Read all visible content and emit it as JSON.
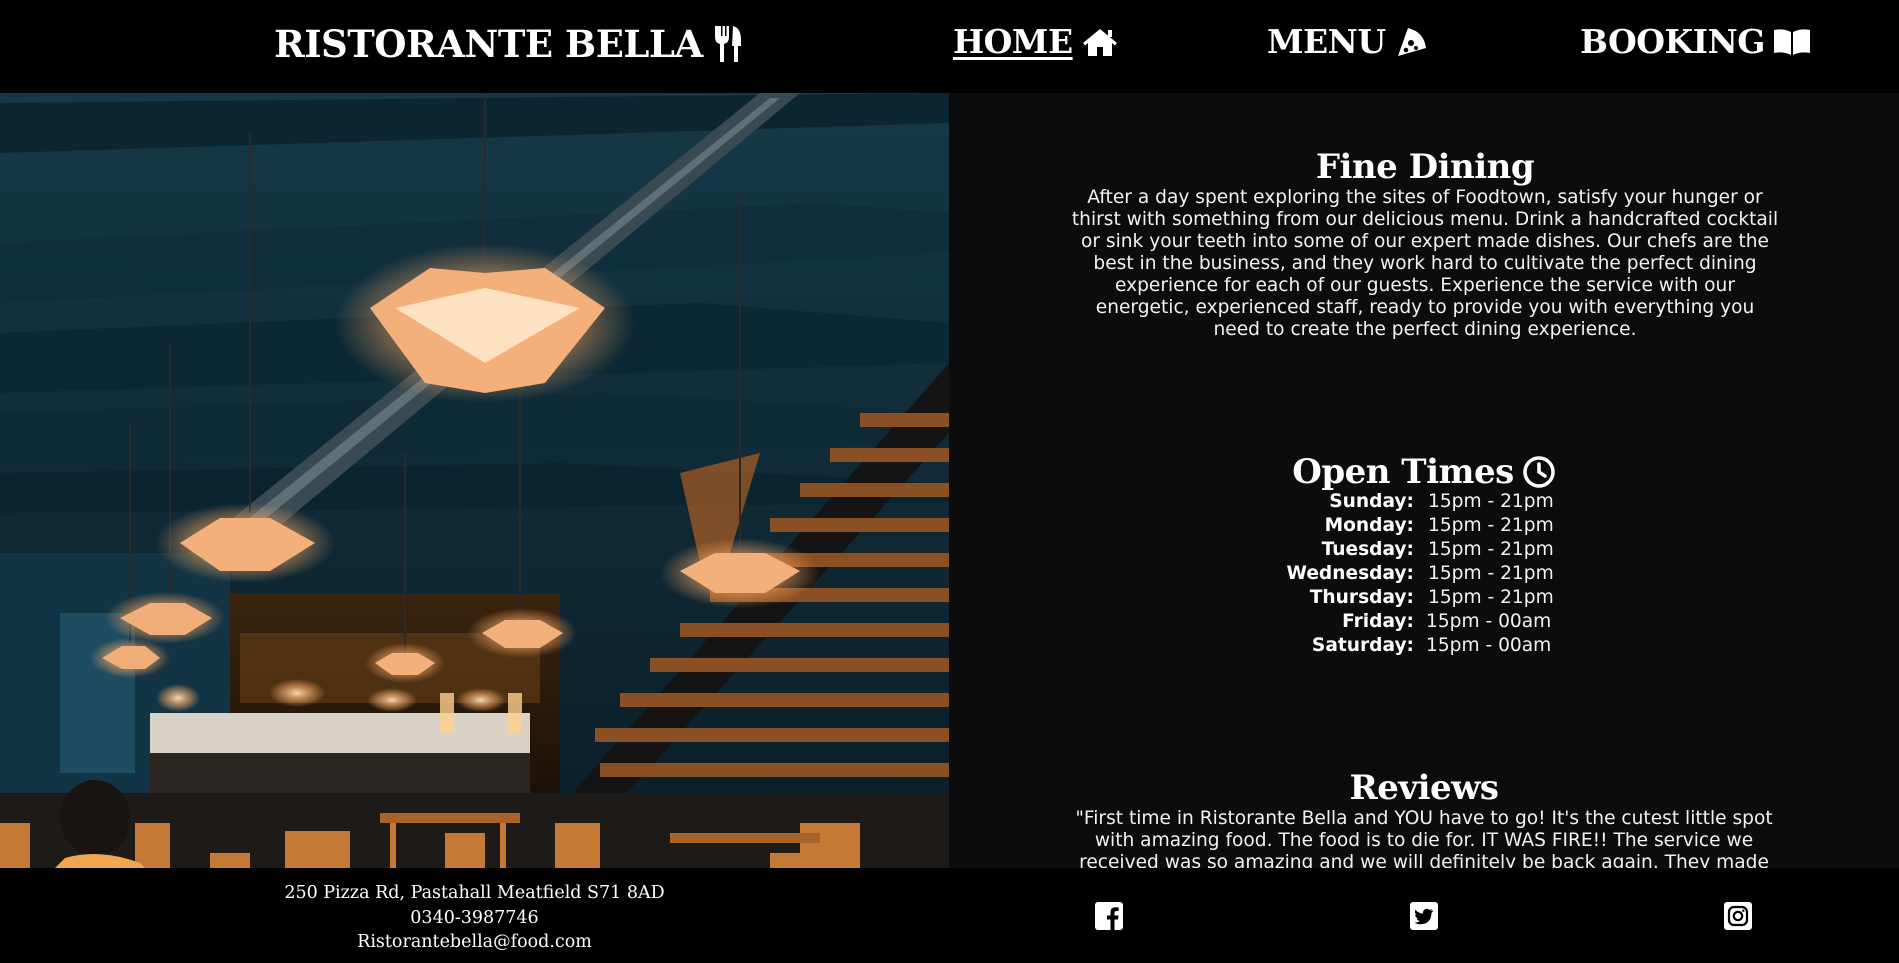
{
  "header": {
    "brand": "RISTORANTE BELLA",
    "brand_icon": "utensils-icon",
    "nav": [
      {
        "label": "HOME",
        "icon": "home-icon",
        "active": true
      },
      {
        "label": "MENU",
        "icon": "pizza-slice-icon",
        "active": false
      },
      {
        "label": "BOOKING",
        "icon": "open-book-icon",
        "active": false
      }
    ]
  },
  "hero": {
    "alt": "Restaurant interior with pendant lamps and staircase"
  },
  "fine_dining": {
    "title": "Fine Dining",
    "text": "After a day spent exploring the sites of Foodtown, satisfy your hunger or thirst with something from our delicious menu. Drink a handcrafted cocktail or sink your teeth into some of our expert made dishes. Our chefs are the best in the business, and they work hard to cultivate the perfect dining experience for each of our guests. Experience the service with our energetic, experienced staff, ready to provide you with everything you need to create the perfect dining experience."
  },
  "open_times": {
    "title": "Open Times",
    "icon": "clock-icon",
    "rows": [
      {
        "day": "Sunday:",
        "time": "15pm - 21pm"
      },
      {
        "day": "Monday:",
        "time": "15pm - 21pm"
      },
      {
        "day": "Tuesday:",
        "time": "15pm - 21pm"
      },
      {
        "day": "Wednesday:",
        "time": "15pm - 21pm"
      },
      {
        "day": "Thursday:",
        "time": "15pm - 21pm"
      },
      {
        "day": "Friday:",
        "time": "15pm - 00am"
      },
      {
        "day": "Saturday:",
        "time": "15pm - 00am"
      }
    ]
  },
  "reviews": {
    "title": "Reviews",
    "text": "\"First time in Ristorante Bella and YOU have to go! It's the cutest little spot with amazing food. The food is to die for. IT WAS FIRE!! The service we received was so amazing and we will definitely be back again. They made us feel welcomed"
  },
  "footer": {
    "address": "250 Pizza Rd, Pastahall Meatfield S71 8AD",
    "phone": "0340-3987746",
    "email": "Ristorantebella@food.com",
    "social": [
      "facebook-icon",
      "twitter-icon",
      "instagram-icon"
    ]
  },
  "colors": {
    "background": "#0d0c0d",
    "bar": "#000000",
    "text": "#ffffff",
    "lamp": "#f3b07a"
  }
}
